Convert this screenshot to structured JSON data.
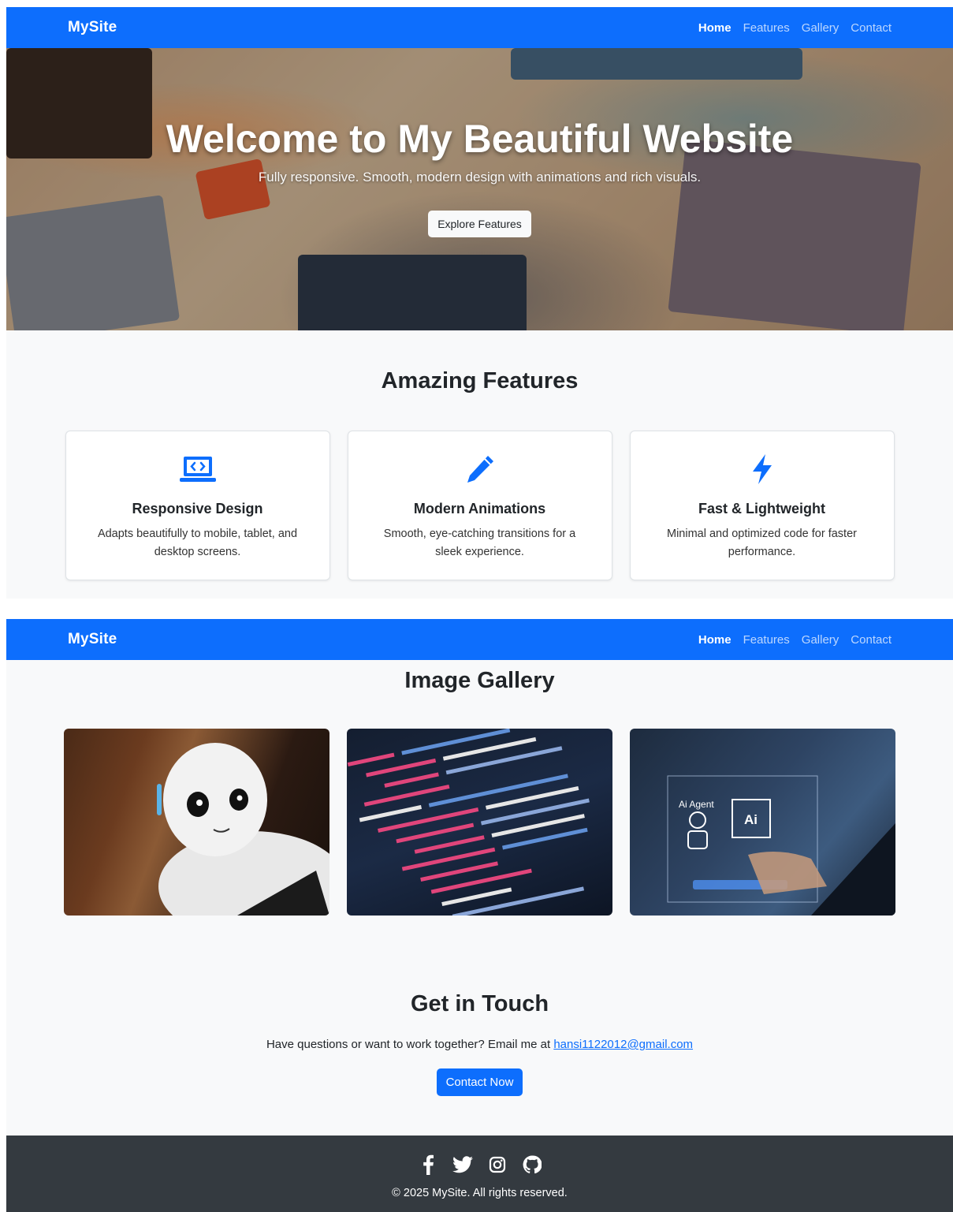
{
  "navbar": {
    "brand": "MySite",
    "links": [
      {
        "label": "Home"
      },
      {
        "label": "Features"
      },
      {
        "label": "Gallery"
      },
      {
        "label": "Contact"
      }
    ]
  },
  "hero": {
    "title": "Welcome to My Beautiful Website",
    "subtitle": "Fully responsive. Smooth, modern design with animations and rich visuals.",
    "button_label": "Explore Features"
  },
  "features": {
    "title": "Amazing Features",
    "items": [
      {
        "icon": "laptop-code-icon",
        "title": "Responsive Design",
        "desc": "Adapts beautifully to mobile, tablet, and desktop screens."
      },
      {
        "icon": "pen-icon",
        "title": "Modern Animations",
        "desc": "Smooth, eye-catching transitions for a sleek experience."
      },
      {
        "icon": "lightning-icon",
        "title": "Fast & Lightweight",
        "desc": "Minimal and optimized code for faster performance."
      }
    ]
  },
  "gallery": {
    "title": "Image Gallery",
    "images": [
      {
        "icon": "robot-photo"
      },
      {
        "icon": "code-photo"
      },
      {
        "icon": "ai-agent-photo",
        "overlay_label_1": "Ai Agent",
        "overlay_label_2": "Ai"
      }
    ]
  },
  "contact": {
    "title": "Get in Touch",
    "text": "Have questions or want to work together? Email me at",
    "email": "hansi1122012@gmail.com",
    "button_label": "Contact Now"
  },
  "footer": {
    "social": [
      "facebook-icon",
      "twitter-icon",
      "instagram-icon",
      "github-icon"
    ],
    "copyright": "© 2025 MySite. All rights reserved."
  },
  "colors": {
    "primary": "#0d6efd",
    "footer_bg": "#343a40",
    "page_bg": "#f8f9fa"
  }
}
